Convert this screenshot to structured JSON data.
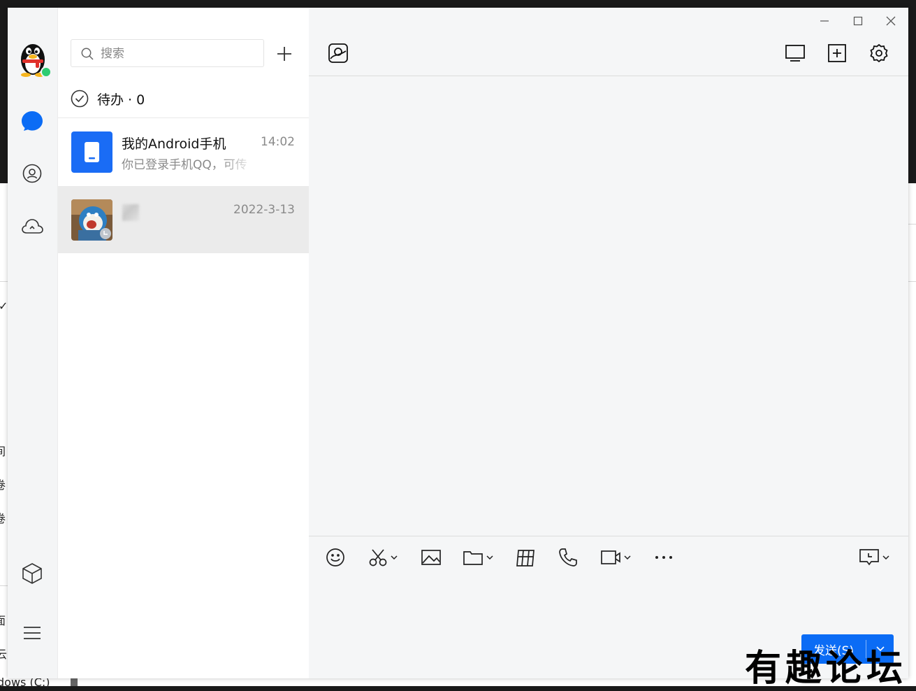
{
  "background_window": {
    "fragments": [
      "✓",
      "间",
      "卷",
      "卷",
      "面",
      "云",
      "dows (C:)"
    ]
  },
  "window_controls": {
    "minimize": "minimize-icon",
    "maximize": "maximize-icon",
    "close": "close-icon"
  },
  "rail": {
    "items": [
      "qq-avatar",
      "chat-icon",
      "contacts-icon",
      "cloud-icon",
      "app-box-icon",
      "menu-icon"
    ]
  },
  "search": {
    "placeholder": "搜索",
    "value": ""
  },
  "todo": {
    "label": "待办 · 0"
  },
  "conversations": [
    {
      "name": "我的Android手机",
      "time": "14:02",
      "last_message": "你已登录手机QQ，可传"
    },
    {
      "name": "",
      "time": "2022-3-13",
      "last_message": ""
    }
  ],
  "chat_toolbar": {
    "left": "gallery-icon",
    "right": [
      "screen-share-icon",
      "add-member-icon",
      "settings-icon"
    ]
  },
  "composer_tools": [
    "emoji-icon",
    "screenshot-icon",
    "image-icon",
    "folder-icon",
    "gift-icon",
    "phone-icon",
    "video-icon",
    "more-icon",
    "message-record-icon"
  ],
  "send_button": {
    "label": "发送(S)"
  },
  "watermark": {
    "text": "有趣论坛"
  },
  "colors": {
    "accent": "#0b6cf5",
    "device_tile": "#1a6cf5",
    "online": "#2ecc71"
  }
}
